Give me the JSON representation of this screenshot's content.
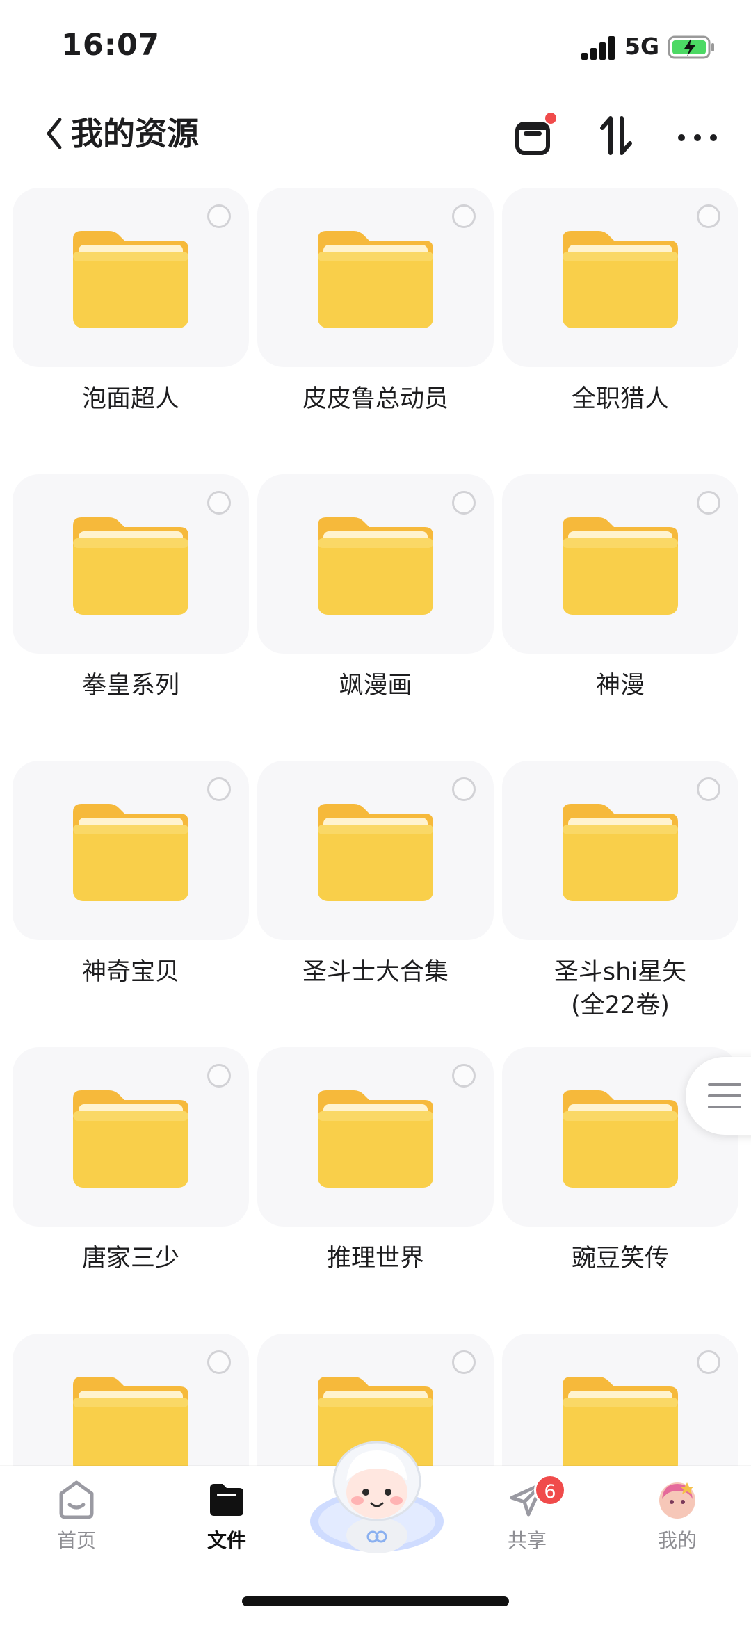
{
  "status_bar": {
    "time": "16:07",
    "network": "5G"
  },
  "header": {
    "back_icon": "chevron-left-icon",
    "title": "我的资源",
    "recycle_icon": "recycle-bin-icon",
    "sort_icon": "sort-icon",
    "more_icon": "more-dots-icon"
  },
  "folders": [
    {
      "name": "泡面超人"
    },
    {
      "name": "皮皮鲁总动员"
    },
    {
      "name": "全职猎人"
    },
    {
      "name": "拳皇系列"
    },
    {
      "name": "飒漫画"
    },
    {
      "name": "神漫"
    },
    {
      "name": "神奇宝贝"
    },
    {
      "name": "圣斗士大合集"
    },
    {
      "name": "圣斗shi星矢\n(全22卷)"
    },
    {
      "name": "唐家三少"
    },
    {
      "name": "推理世界"
    },
    {
      "name": "豌豆笑传"
    },
    {
      "name": ""
    },
    {
      "name": ""
    },
    {
      "name": ""
    }
  ],
  "tabbar": {
    "tabs": [
      {
        "label": "首页",
        "icon": "home-icon"
      },
      {
        "label": "文件",
        "icon": "folder-icon",
        "active": true
      },
      {
        "label": "共享",
        "icon": "share-plane-icon",
        "badge": "6"
      },
      {
        "label": "我的",
        "icon": "avatar-icon"
      }
    ]
  },
  "colors": {
    "folder_yellow": "#F9CF4A",
    "badge_red": "#F04B4B",
    "card_bg": "#F7F7F9"
  }
}
